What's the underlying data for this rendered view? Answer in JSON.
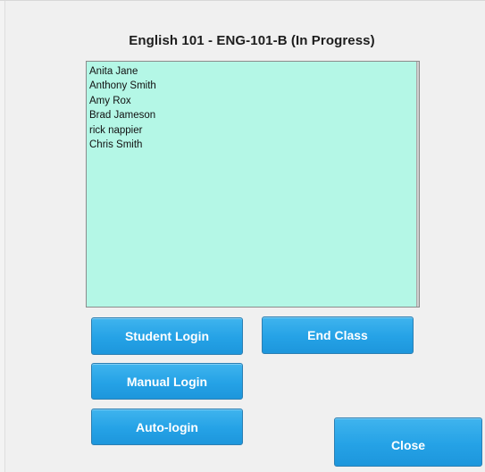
{
  "dialog": {
    "title": "English 101 - ENG-101-B (In Progress)"
  },
  "students": [
    "Anita Jane",
    "Anthony Smith",
    "Amy Rox",
    "Brad Jameson",
    "rick nappier",
    "Chris Smith"
  ],
  "buttons": {
    "student_login": "Student Login",
    "end_class": "End Class",
    "manual_login": "Manual Login",
    "auto_login": "Auto-login",
    "close": "Close"
  },
  "colors": {
    "list_background": "#b4f7e6",
    "button_blue": "#25a2e6",
    "button_text": "#ffffff",
    "window_background": "#f0f0f0"
  }
}
